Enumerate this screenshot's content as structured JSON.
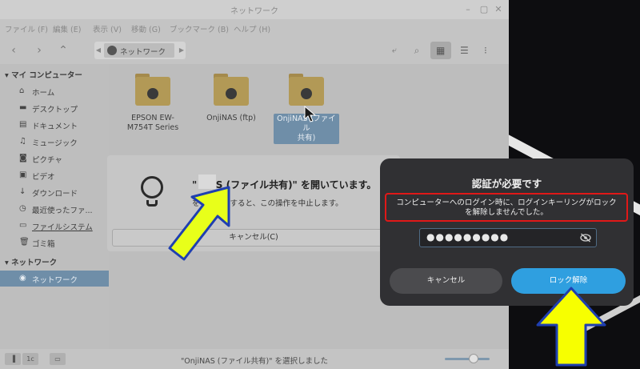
{
  "window": {
    "title": "ネットワーク"
  },
  "menubar": {
    "items": [
      "ファイル (F)",
      "編集 (E)",
      "表示 (V)",
      "移動 (G)",
      "ブックマーク (B)",
      "ヘルプ (H)"
    ]
  },
  "toolbar": {
    "path_item": "ネットワーク",
    "icons": [
      "back-icon",
      "forward-icon",
      "up-icon",
      "connect-icon",
      "search-icon",
      "grid-view-icon",
      "list-view-icon",
      "compact-view-icon"
    ]
  },
  "sidebar": {
    "sections": [
      {
        "header": "マイ コンピューター",
        "items": [
          {
            "label": "ホーム",
            "icon": "home-icon"
          },
          {
            "label": "デスクトップ",
            "icon": "desktop-icon"
          },
          {
            "label": "ドキュメント",
            "icon": "documents-icon"
          },
          {
            "label": "ミュージック",
            "icon": "music-icon"
          },
          {
            "label": "ピクチャ",
            "icon": "pictures-icon"
          },
          {
            "label": "ビデオ",
            "icon": "videos-icon"
          },
          {
            "label": "ダウンロード",
            "icon": "downloads-icon"
          },
          {
            "label": "最近使ったファ...",
            "icon": "recent-icon"
          },
          {
            "label": "ファイルシステム",
            "icon": "filesystem-icon"
          },
          {
            "label": "ゴミ箱",
            "icon": "trash-icon"
          }
        ]
      },
      {
        "header": "ネットワーク",
        "items": [
          {
            "label": "ネットワーク",
            "icon": "network-icon",
            "selected": true
          }
        ]
      }
    ]
  },
  "files": [
    {
      "name_line1": "EPSON EW-",
      "name_line2": "M754T Series"
    },
    {
      "name_line1": "OnjiNAS (ftp)",
      "name_line2": ""
    },
    {
      "name_line1": "OnjiNAS (ファイル",
      "name_line2": "共有)",
      "selected": true
    }
  ],
  "mount_dialog": {
    "title": "\"  NAS (ファイル共有)\" を開いています。",
    "body": "をクリックすると、この操作を中止します。",
    "cancel": "キャンセル(C)"
  },
  "auth_dialog": {
    "title": "認証が必要です",
    "message": "コンピューターへのログイン時に、ログインキーリングがロックを解除しませんでした。",
    "password_mask": "●●●●●●●●●",
    "cancel": "キャンセル",
    "unlock": "ロック解除",
    "colors": {
      "unlock": "#2f9fe0",
      "highlight_border": "#e01818"
    }
  },
  "statusbar": {
    "text": "\"OnjiNAS (ファイル共有)\" を選択しました",
    "buttons": [
      "sidebar-toggle",
      "1c",
      "terminal"
    ]
  },
  "annotations": {
    "arrow_color": "#e8ff1a"
  }
}
